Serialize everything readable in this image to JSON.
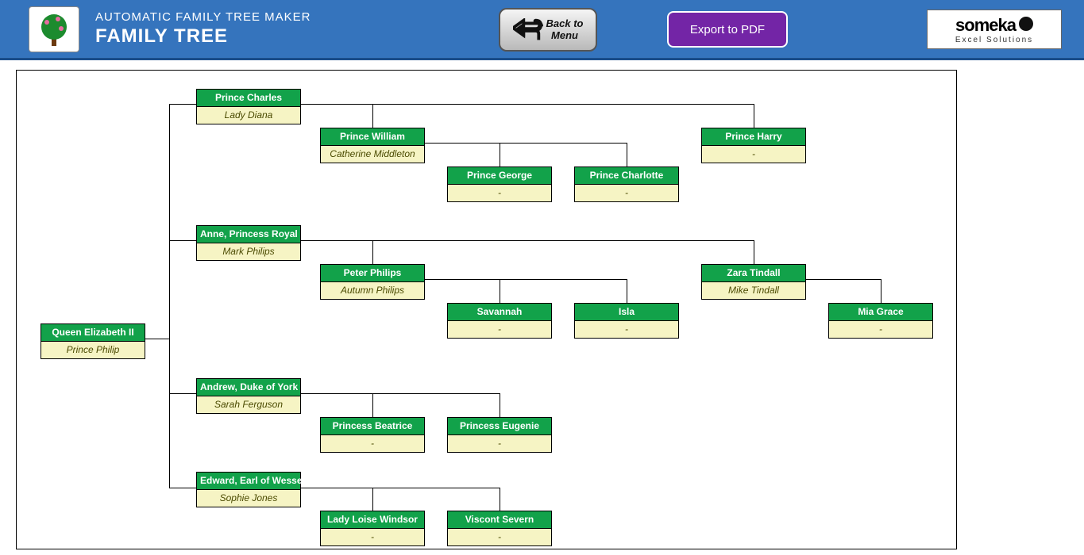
{
  "header": {
    "app_title": "AUTOMATIC FAMILY TREE MAKER",
    "page_title": "FAMILY TREE",
    "back_label": "Back to Menu",
    "export_label": "Export to PDF",
    "brand_main": "someka",
    "brand_sub": "Excel Solutions"
  },
  "tree": {
    "root": {
      "name": "Queen Elizabeth II",
      "spouse": "Prince Philip"
    },
    "children": [
      {
        "name": "Prince Charles",
        "spouse": "Lady Diana",
        "children": [
          {
            "name": "Prince William",
            "spouse": "Catherine Middleton",
            "children": [
              {
                "name": "Prince George",
                "spouse": "-"
              },
              {
                "name": "Prince Charlotte",
                "spouse": "-"
              }
            ]
          },
          {
            "name": "Prince Harry",
            "spouse": "-"
          }
        ]
      },
      {
        "name": "Anne, Princess Royal",
        "spouse": "Mark Philips",
        "children": [
          {
            "name": "Peter Philips",
            "spouse": "Autumn Philips",
            "children": [
              {
                "name": "Savannah",
                "spouse": "-"
              },
              {
                "name": "Isla",
                "spouse": "-"
              }
            ]
          },
          {
            "name": "Zara Tindall",
            "spouse": "Mike Tindall",
            "children": [
              {
                "name": "Mia Grace",
                "spouse": "-"
              }
            ]
          }
        ]
      },
      {
        "name": "Andrew, Duke of York",
        "spouse": "Sarah Ferguson",
        "children": [
          {
            "name": "Princess Beatrice",
            "spouse": "-"
          },
          {
            "name": "Princess Eugenie",
            "spouse": "-"
          }
        ]
      },
      {
        "name": "Edward, Earl of Wessex",
        "spouse": "Sophie Jones",
        "children": [
          {
            "name": "Lady Loise Windsor",
            "spouse": "-"
          },
          {
            "name": "Viscont Severn",
            "spouse": "-"
          }
        ]
      }
    ]
  }
}
